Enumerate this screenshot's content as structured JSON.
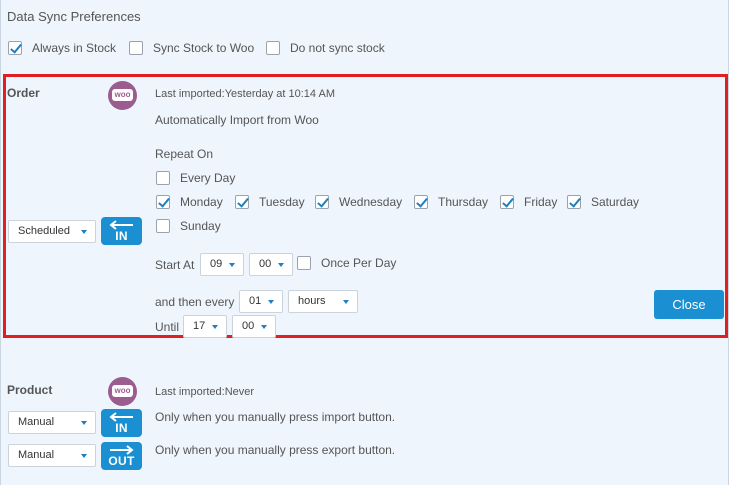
{
  "prefs": {
    "title": "Data Sync Preferences",
    "options": [
      {
        "label": "Always in Stock",
        "checked": true
      },
      {
        "label": "Sync Stock to Woo",
        "checked": false
      },
      {
        "label": "Do not sync stock",
        "checked": false
      }
    ]
  },
  "order": {
    "label": "Order",
    "logo_text": "woo",
    "last_imported": "Last imported:Yesterday at 10:14 AM",
    "auto_import": "Automatically Import from Woo",
    "repeat_on": "Repeat On",
    "every_day": "Every Day",
    "days": [
      {
        "label": "Monday",
        "checked": true
      },
      {
        "label": "Tuesday",
        "checked": true
      },
      {
        "label": "Wednesday",
        "checked": true
      },
      {
        "label": "Thursday",
        "checked": true
      },
      {
        "label": "Friday",
        "checked": true
      },
      {
        "label": "Saturday",
        "checked": true
      },
      {
        "label": "Sunday",
        "checked": false
      }
    ],
    "mode": "Scheduled",
    "in_label": "IN",
    "start_at_label": "Start At",
    "start_hour": "09",
    "start_min": "00",
    "once_per_day": "Once Per Day",
    "then_every_label": "and then every",
    "interval": "01",
    "interval_unit": "hours",
    "until_label": "Until",
    "until_hour": "17",
    "until_min": "00",
    "close_label": "Close"
  },
  "product": {
    "label": "Product",
    "logo_text": "woo",
    "last_imported": "Last imported:Never",
    "import_mode": "Manual",
    "export_mode": "Manual",
    "in_label": "IN",
    "out_label": "OUT",
    "import_desc": "Only when you manually press import button.",
    "export_desc": "Only when you manually press export button."
  }
}
